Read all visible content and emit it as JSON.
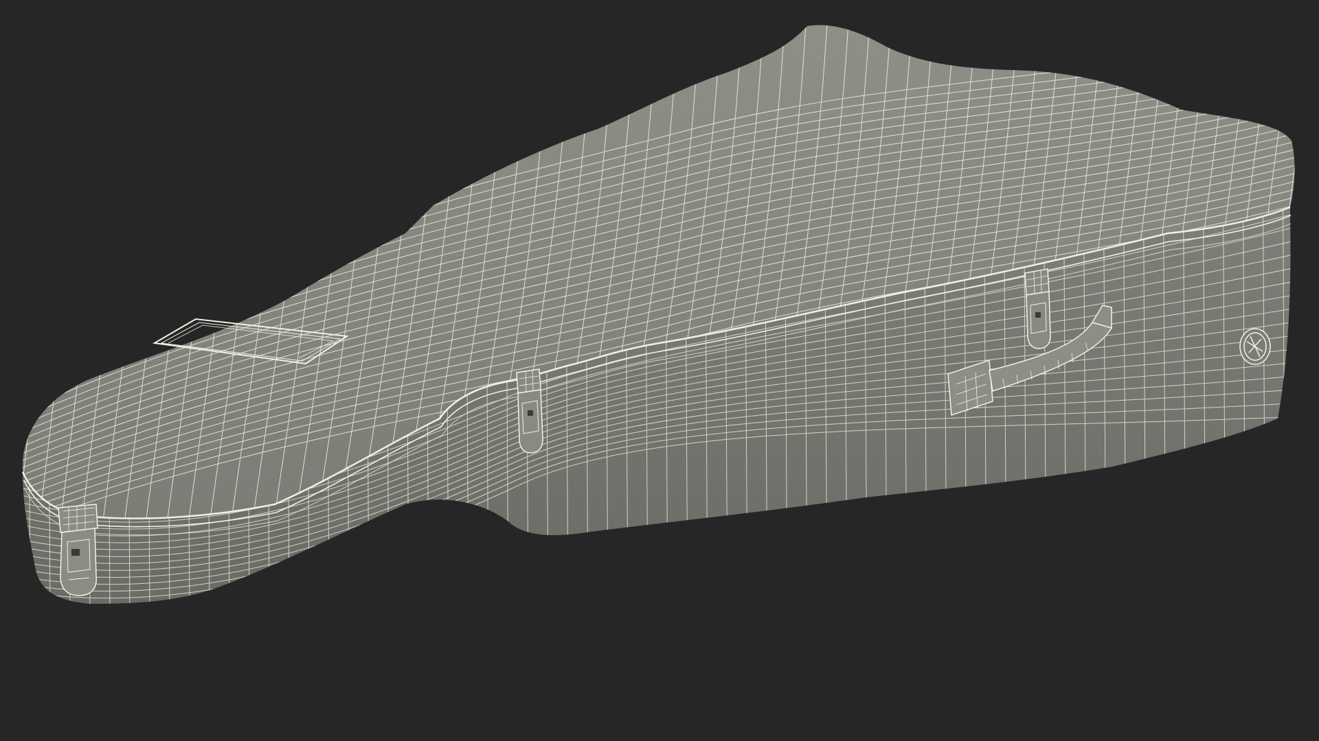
{
  "scene": {
    "subject": "guitar-case-wireframe",
    "background_color": "#262626",
    "mesh_color": "#e8e8dc",
    "shell_top_color": "#8a8b83",
    "shell_side_color": "#7a7b74",
    "shell_dark_color": "#676861",
    "hardware_color": "#9c9c92"
  },
  "parts": {
    "latches": [
      "latch-lower-bout",
      "latch-waist",
      "latch-upper-bout"
    ],
    "handle": "carry-handle",
    "badge": "brand-badge-icon",
    "pocket": "accessory-pocket"
  }
}
